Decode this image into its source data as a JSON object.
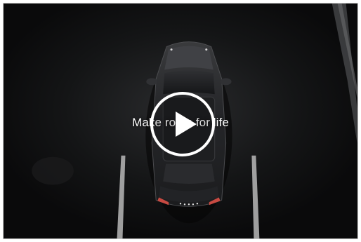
{
  "video": {
    "title_overlay": "Make room for life",
    "play_button_icon": "play-icon"
  },
  "colors": {
    "background": "#0d0d0e",
    "overlay_text": "#ffffff",
    "play_ring": "#ffffff",
    "tail_light": "#c84a42"
  }
}
